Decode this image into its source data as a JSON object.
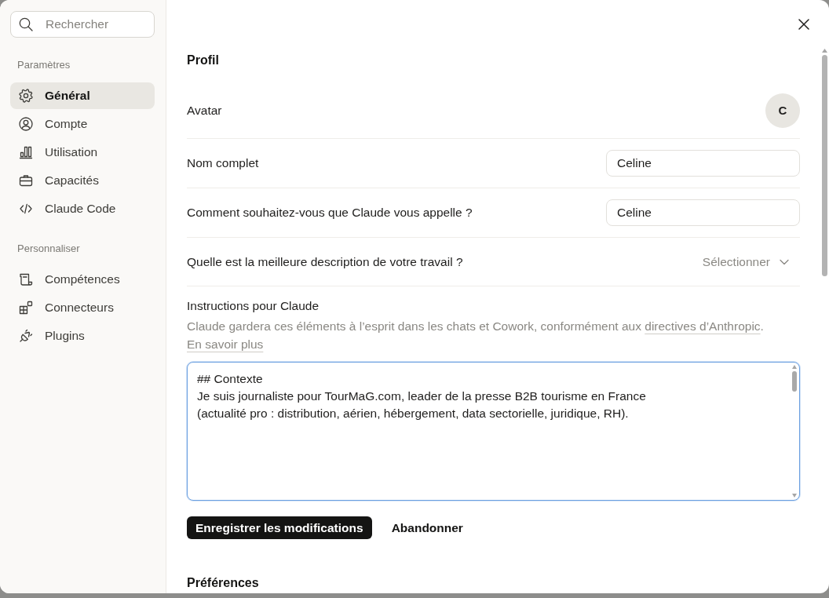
{
  "sidebar": {
    "search": {
      "placeholder": "Rechercher"
    },
    "sections": [
      {
        "title": "Paramètres",
        "items": [
          {
            "label": "Général",
            "selected": true
          },
          {
            "label": "Compte",
            "selected": false
          },
          {
            "label": "Utilisation",
            "selected": false
          },
          {
            "label": "Capacités",
            "selected": false
          },
          {
            "label": "Claude Code",
            "selected": false
          }
        ]
      },
      {
        "title": "Personnaliser",
        "items": [
          {
            "label": "Compétences",
            "selected": false
          },
          {
            "label": "Connecteurs",
            "selected": false
          },
          {
            "label": "Plugins",
            "selected": false
          }
        ]
      }
    ]
  },
  "profile": {
    "title": "Profil",
    "avatar": {
      "label": "Avatar",
      "initial": "C"
    },
    "fields": [
      {
        "kind": "text",
        "label": "Nom complet",
        "value": "Celine"
      },
      {
        "kind": "text",
        "label": "Comment souhaitez-vous que Claude vous appelle ?",
        "value": "Celine"
      },
      {
        "kind": "select",
        "label": "Quelle est la meilleure description de votre travail ?",
        "placeholder": "Sélectionner"
      }
    ],
    "instructions": {
      "label": "Instructions pour Claude",
      "description": [
        {
          "kind": "text",
          "text": "Claude gardera ces éléments à l’esprit dans les chats et Cowork, conformément aux "
        },
        {
          "kind": "link",
          "text": "directives d’Anthropic"
        },
        {
          "kind": "text",
          "text": ". "
        },
        {
          "kind": "link",
          "text": "En savoir plus"
        }
      ],
      "value": "## Contexte\nJe suis journaliste pour TourMaG.com, leader de la presse B2B tourisme en France\n(actualité pro : distribution, aérien, hébergement, data sectorielle, juridique, RH).",
      "focused": true
    },
    "buttons": [
      {
        "kind": "primary",
        "label": "Enregistrer les modifications"
      },
      {
        "kind": "secondary",
        "label": "Abandonner"
      }
    ]
  },
  "next_section": {
    "title": "Préférences"
  }
}
